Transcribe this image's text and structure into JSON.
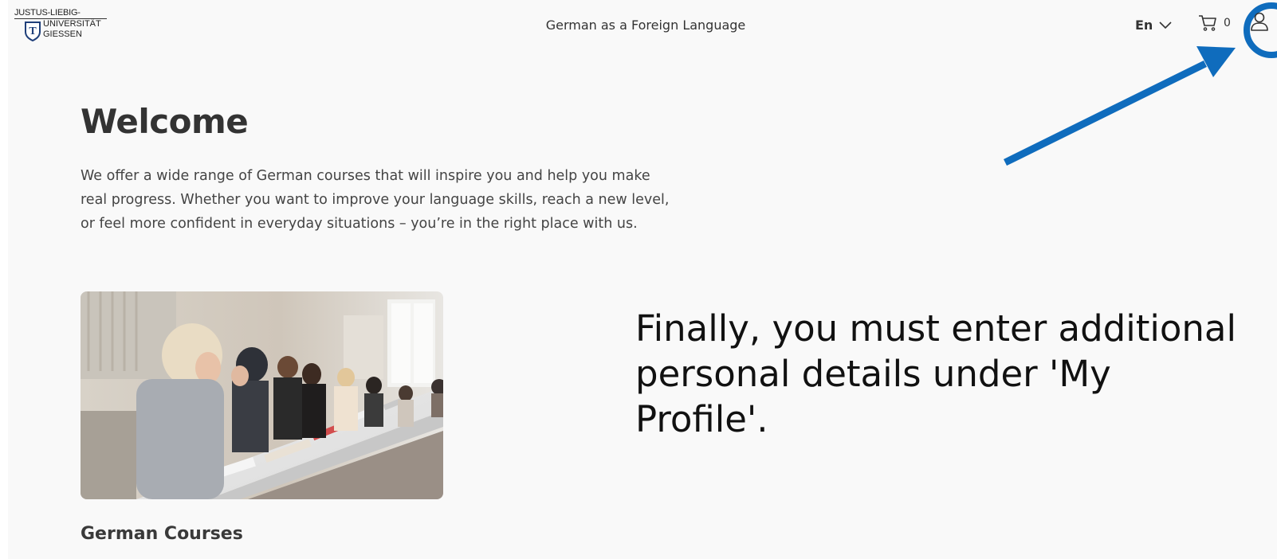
{
  "header": {
    "logo": {
      "line1": "JUSTUS-LIEBIG-",
      "line2": "UNIVERSITÄT",
      "line3": "GIESSEN",
      "shield_letter": "T"
    },
    "title": "German as a Foreign Language",
    "language": {
      "selected": "En",
      "icon": "chevron-down-icon"
    },
    "cart": {
      "count": "0",
      "icon": "cart-icon"
    },
    "profile": {
      "icon": "user-icon"
    }
  },
  "main": {
    "heading": "Welcome",
    "intro_lines": [
      "We offer a wide range of German courses that will inspire you and help you make",
      "real progress. Whether you want to improve your language skills, reach a new level,",
      "or feel more confident in everyday situations – you’re in the right place with us."
    ],
    "section_heading": "German Courses"
  },
  "annotation": {
    "lines": [
      "Finally, you must enter additional",
      "personal details under 'My",
      "Profile'."
    ],
    "color": "#0f6cbd"
  },
  "colors": {
    "page_bg": "#f9f9f9",
    "text": "#333333",
    "accent": "#0f6cbd"
  }
}
